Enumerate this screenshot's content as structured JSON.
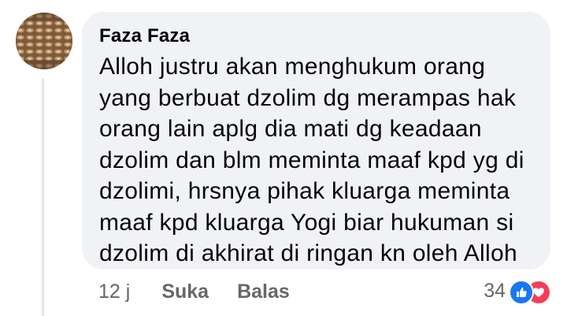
{
  "comment": {
    "author": "Faza Faza",
    "body_lines": [
      "Alloh justru akan menghukum orang",
      "yang berbuat dzolim dg merampas hak",
      "orang lain aplg dia mati dg keadaan",
      "dzolim dan blm meminta maaf kpd yg di",
      "dzolimi, hrsnya pihak kluarga meminta",
      "maaf kpd kluarga Yogi biar hukuman si",
      "dzolim di akhirat di ringan kn oleh Alloh"
    ]
  },
  "actions": {
    "timestamp": "12 j",
    "like_label": "Suka",
    "reply_label": "Balas"
  },
  "reactions": {
    "count": "34",
    "icons": [
      "like-icon",
      "love-icon"
    ]
  },
  "colors": {
    "bubble": "#f0f2f5",
    "meta_text": "#65676b",
    "like": "#1877f2",
    "love": "#f33e58"
  }
}
